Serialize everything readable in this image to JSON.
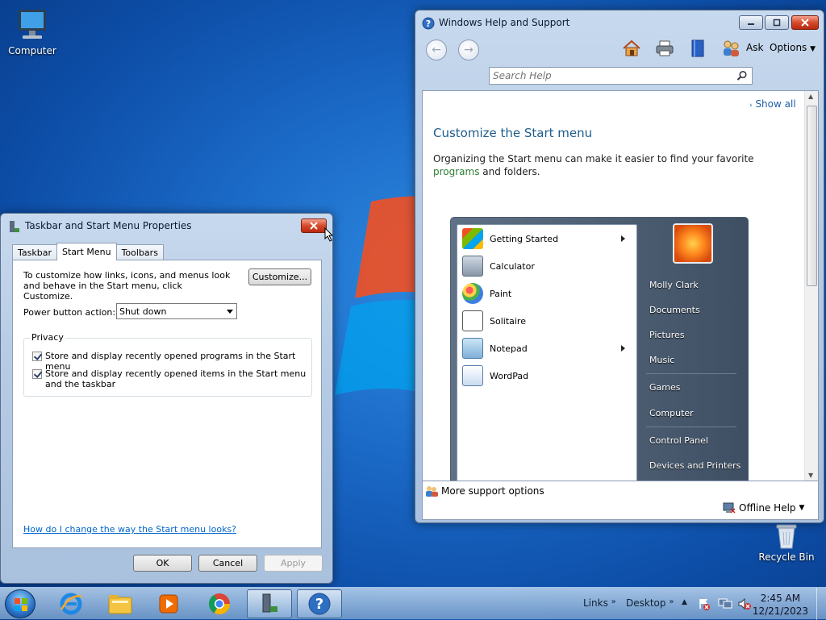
{
  "desktop": {
    "icons": [
      {
        "label": "Computer",
        "icon": "computer-icon"
      },
      {
        "label": "Recycle Bin",
        "icon": "recycle-bin-icon"
      }
    ]
  },
  "props_dialog": {
    "title": "Taskbar and Start Menu Properties",
    "tabs": [
      {
        "label": "Taskbar"
      },
      {
        "label": "Start Menu",
        "active": true
      },
      {
        "label": "Toolbars"
      }
    ],
    "description": "To customize how links, icons, and menus look and behave in the Start menu, click Customize.",
    "customize_label": "Customize...",
    "power_button_label": "Power button action:",
    "power_button_value": "Shut down",
    "privacy_label": "Privacy",
    "checkboxes": [
      {
        "label": "Store and display recently opened programs in the Start menu",
        "checked": true
      },
      {
        "label": "Store and display recently opened items in the Start menu and the taskbar",
        "checked": true
      }
    ],
    "help_link": "How do I change the way the Start menu looks?",
    "ok_label": "OK",
    "cancel_label": "Cancel",
    "apply_label": "Apply"
  },
  "help_window": {
    "title": "Windows Help and Support",
    "ask_label": "Ask",
    "options_label": "Options",
    "search_placeholder": "Search Help",
    "show_all": "Show all",
    "heading": "Customize the Start menu",
    "para_before": "Organizing the Start menu can make it easier to find your favorite ",
    "para_link": "programs",
    "para_after": " and folders.",
    "start_menu_left": [
      {
        "label": "Getting Started",
        "submenu": true
      },
      {
        "label": "Calculator",
        "submenu": false
      },
      {
        "label": "Paint",
        "submenu": false
      },
      {
        "label": "Solitaire",
        "submenu": false
      },
      {
        "label": "Notepad",
        "submenu": true
      },
      {
        "label": "WordPad",
        "submenu": false
      }
    ],
    "start_menu_right": [
      "Molly Clark",
      "Documents",
      "Pictures",
      "Music",
      "Games",
      "Computer",
      "Control Panel",
      "Devices and Printers"
    ],
    "more_support": "More support options",
    "offline_help": "Offline Help"
  },
  "taskbar": {
    "links_label": "Links",
    "desktop_label": "Desktop",
    "time": "2:45 AM",
    "date": "12/21/2023"
  },
  "colors": {
    "accent": "#1f5fa8",
    "link": "#0066cc",
    "heading": "#1e5c8c",
    "program_link": "#2e7d32"
  }
}
